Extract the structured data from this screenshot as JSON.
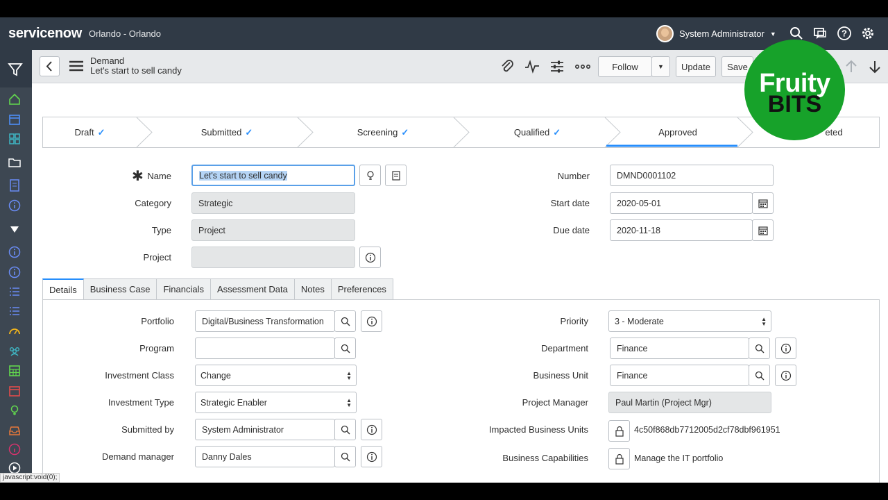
{
  "header": {
    "logo": "servicenow",
    "instance": "Orlando - Orlando",
    "user": "System Administrator"
  },
  "formbar": {
    "table": "Demand",
    "record": "Let's start to sell candy",
    "follow_label": "Follow",
    "update_label": "Update",
    "save_label": "Save"
  },
  "flow": {
    "stages": [
      {
        "label": "Draft",
        "done": true
      },
      {
        "label": "Submitted",
        "done": true
      },
      {
        "label": "Screening",
        "done": true
      },
      {
        "label": "Qualified",
        "done": true
      },
      {
        "label": "Approved",
        "done": false,
        "current": true
      },
      {
        "label": "eted",
        "done": false
      }
    ]
  },
  "form": {
    "name_label": "Name",
    "name_value": "Let's start to sell candy",
    "category_label": "Category",
    "category_value": "Strategic",
    "type_label": "Type",
    "type_value": "Project",
    "project_label": "Project",
    "project_value": "",
    "number_label": "Number",
    "number_value": "DMND0001102",
    "start_label": "Start date",
    "start_value": "2020-05-01",
    "due_label": "Due date",
    "due_value": "2020-11-18"
  },
  "tabs": [
    "Details",
    "Business Case",
    "Financials",
    "Assessment Data",
    "Notes",
    "Preferences"
  ],
  "details": {
    "portfolio_label": "Portfolio",
    "portfolio_value": "Digital/Business Transformation",
    "program_label": "Program",
    "program_value": "",
    "invclass_label": "Investment Class",
    "invclass_value": "Change",
    "invtype_label": "Investment Type",
    "invtype_value": "Strategic Enabler",
    "submitted_label": "Submitted by",
    "submitted_value": "System Administrator",
    "manager_label": "Demand manager",
    "manager_value": "Danny Dales",
    "priority_label": "Priority",
    "priority_value": "3 - Moderate",
    "dept_label": "Department",
    "dept_value": "Finance",
    "bu_label": "Business Unit",
    "bu_value": "Finance",
    "pm_label": "Project Manager",
    "pm_value": "Paul Martin (Project Mgr)",
    "ibu_label": "Impacted Business Units",
    "ibu_value": "4c50f868db7712005d2cf78dbf961951",
    "bc_label": "Business Capabilities",
    "bc_value": "Manage the IT portfolio"
  },
  "statusbar": "javascript:void(0);",
  "watermark": {
    "line1": "Fruity",
    "line2": "BITS"
  },
  "colors": {
    "header": "#303a46",
    "nav": "#3d4752",
    "accent": "#278efc",
    "badge": "#17a22a"
  }
}
